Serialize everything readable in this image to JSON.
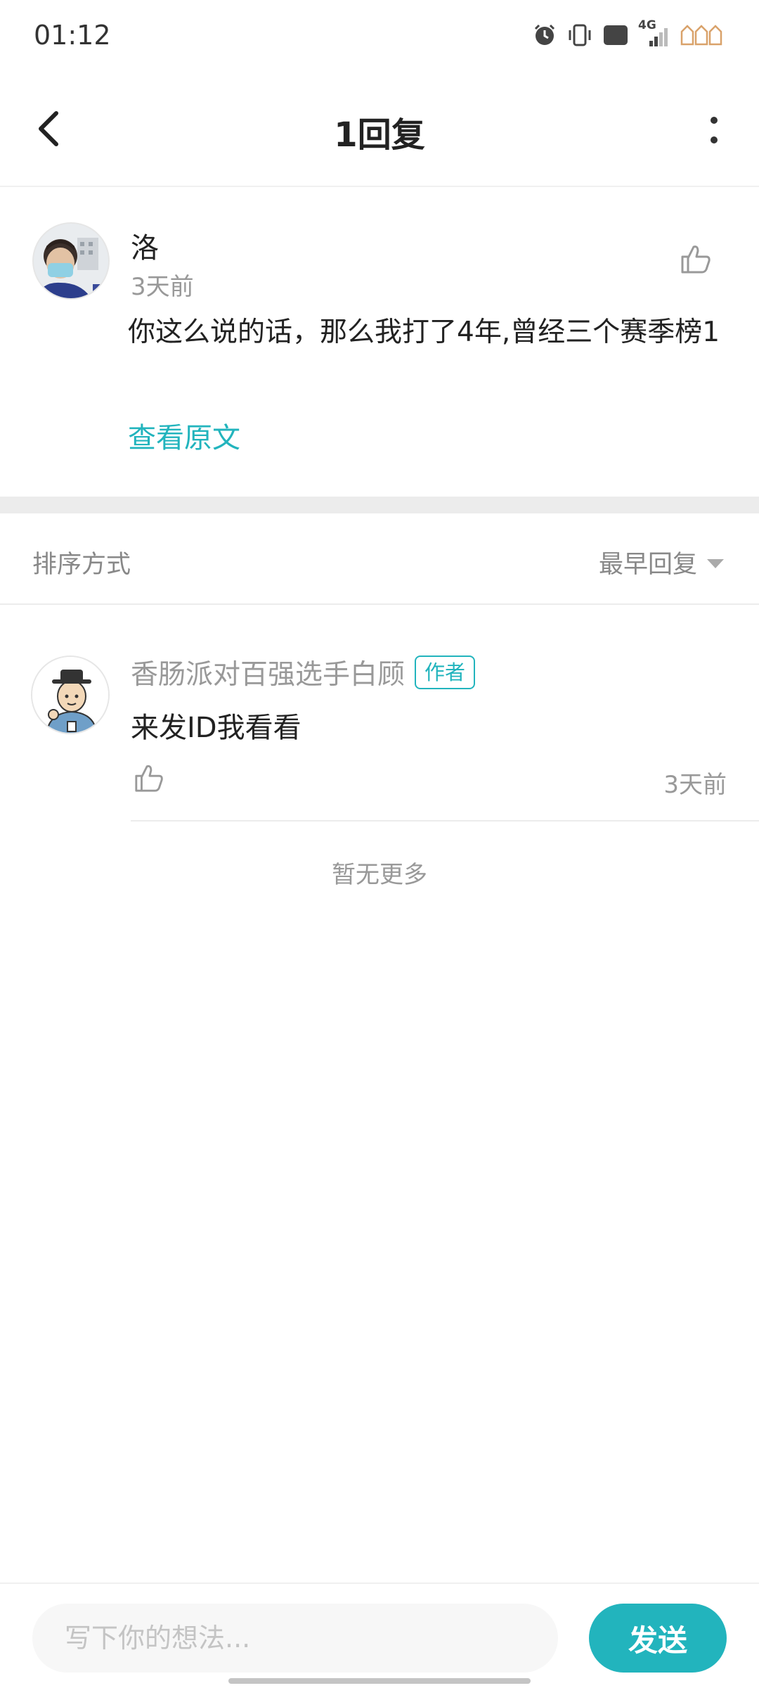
{
  "status_bar": {
    "time": "01:12",
    "icons": [
      "alarm-icon",
      "vibrate-icon",
      "hd-icon",
      "4g-signal-icon",
      "battery-icon"
    ],
    "network_label": "4G",
    "hd_label": "HD"
  },
  "header": {
    "title": "1回复",
    "back_icon": "chevron-left-icon",
    "more_icon": "more-vertical-icon"
  },
  "main_comment": {
    "username": "洛",
    "time": "3天前",
    "text": "你这么说的话，那么我打了4年,曾经三个赛季榜1",
    "view_original": "查看原文",
    "like_icon": "thumbs-up-icon"
  },
  "sort": {
    "label": "排序方式",
    "selected": "最早回复"
  },
  "replies": [
    {
      "username": "香肠派对百强选手白顾",
      "badge": "作者",
      "text": "来发ID我看看",
      "time": "3天前"
    }
  ],
  "list_footer": "暂无更多",
  "composer": {
    "placeholder": "写下你的想法...",
    "value": "",
    "send_label": "发送"
  },
  "colors": {
    "accent": "#22b4bd",
    "text_primary": "#222222",
    "text_secondary": "#999999",
    "divider": "#ececec"
  }
}
